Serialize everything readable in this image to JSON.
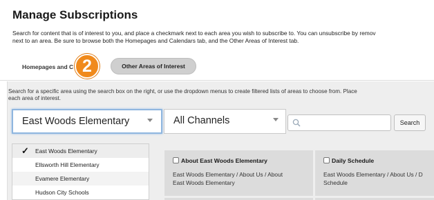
{
  "page": {
    "title": "Manage Subscriptions",
    "intro_line1": "Search for content that is of interest to you, and place a checkmark next to each area you wish to subscribe to. You can unsubscribe by remov",
    "intro_line2": "next to an area. Be sure to browse both the Homepages and Calendars tab, and the Other Areas of Interest tab."
  },
  "tabs": [
    {
      "label": "Homepages and C",
      "active": false
    },
    {
      "label": "Other Areas of Interest",
      "active": true
    }
  ],
  "step_badge": "2",
  "help": {
    "line1": "Search for a specific area using the search box on the right, or use the dropdown menus to create filtered lists of areas to choose from. Place",
    "line2": "each area of interest."
  },
  "filters": {
    "area_select": "East Woods Elementary",
    "channel_select": "All Channels",
    "search_placeholder": "",
    "search_button": "Search"
  },
  "area_list": [
    {
      "label": "East Woods Elementary",
      "checked": true
    },
    {
      "label": "Ellsworth Hill Elementary",
      "checked": false
    },
    {
      "label": "Evamere Elementary",
      "checked": false
    },
    {
      "label": "Hudson City Schools",
      "checked": false
    }
  ],
  "cards": [
    {
      "title": "About East Woods Elementary",
      "path_line1": "East Woods Elementary / About Us / About",
      "path_line2": "East Woods Elementary"
    },
    {
      "title": "Daily Schedule",
      "path_line1": "East Woods Elementary / About Us / D",
      "path_line2": "Schedule"
    }
  ],
  "icons": {
    "check": "✓",
    "search": "search-icon",
    "dropdown": "chevron-down-icon"
  },
  "colors": {
    "badge": "#f08a1c",
    "active_tab": "#cfcfcf",
    "focus_border": "#8fb6df",
    "panel_bg": "#eeeeee",
    "card_bg": "#dcdcdc"
  }
}
